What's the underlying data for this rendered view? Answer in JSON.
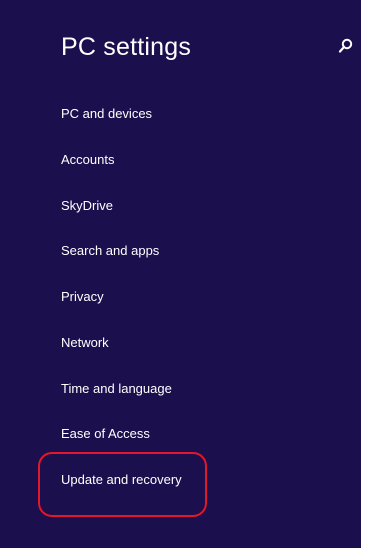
{
  "header": {
    "title": "PC settings",
    "search_icon": "search-icon"
  },
  "nav": {
    "items": [
      {
        "label": "PC and devices"
      },
      {
        "label": "Accounts"
      },
      {
        "label": "SkyDrive"
      },
      {
        "label": "Search and apps"
      },
      {
        "label": "Privacy"
      },
      {
        "label": "Network"
      },
      {
        "label": "Time and language"
      },
      {
        "label": "Ease of Access"
      },
      {
        "label": "Update and recovery"
      }
    ]
  },
  "colors": {
    "background": "#1b0f4d",
    "text": "#ffffff",
    "highlight": "#e3182a"
  }
}
